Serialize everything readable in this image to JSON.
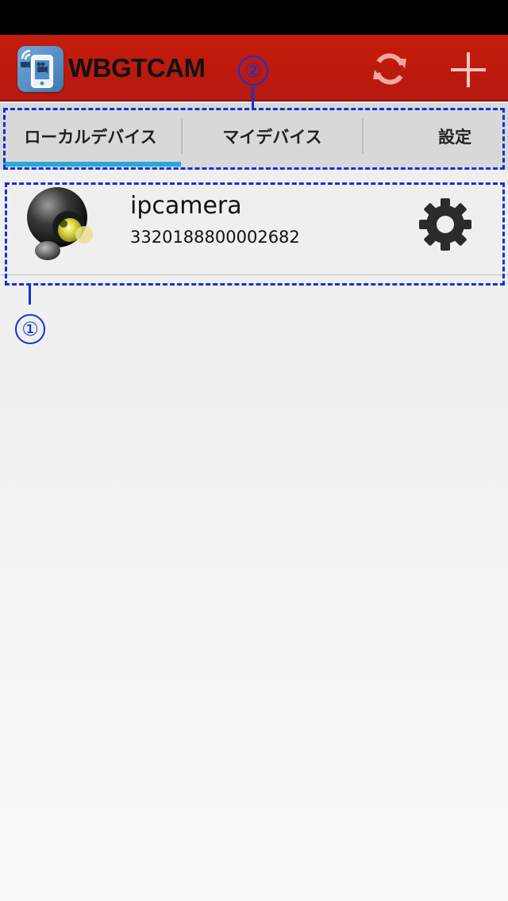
{
  "app": {
    "title": "WBGTCAM"
  },
  "tabs": [
    {
      "label": "ローカルデバイス",
      "selected": true
    },
    {
      "label": "マイデバイス",
      "selected": false
    },
    {
      "label": "設定",
      "selected": false
    }
  ],
  "devices": [
    {
      "name": "ipcamera",
      "id": "3320188800002682"
    }
  ],
  "annotations": {
    "callout_1": "①",
    "callout_2": "②"
  },
  "colors": {
    "app_bar": "#c61b0b",
    "tab_indicator": "#2aa7d6",
    "annotation": "#1431d8"
  },
  "icons": {
    "app": "camera-phone-app-icon",
    "refresh": "refresh-icon",
    "add": "plus-icon",
    "device_settings": "gear-icon",
    "device_thumbnail": "ip-camera-icon"
  }
}
